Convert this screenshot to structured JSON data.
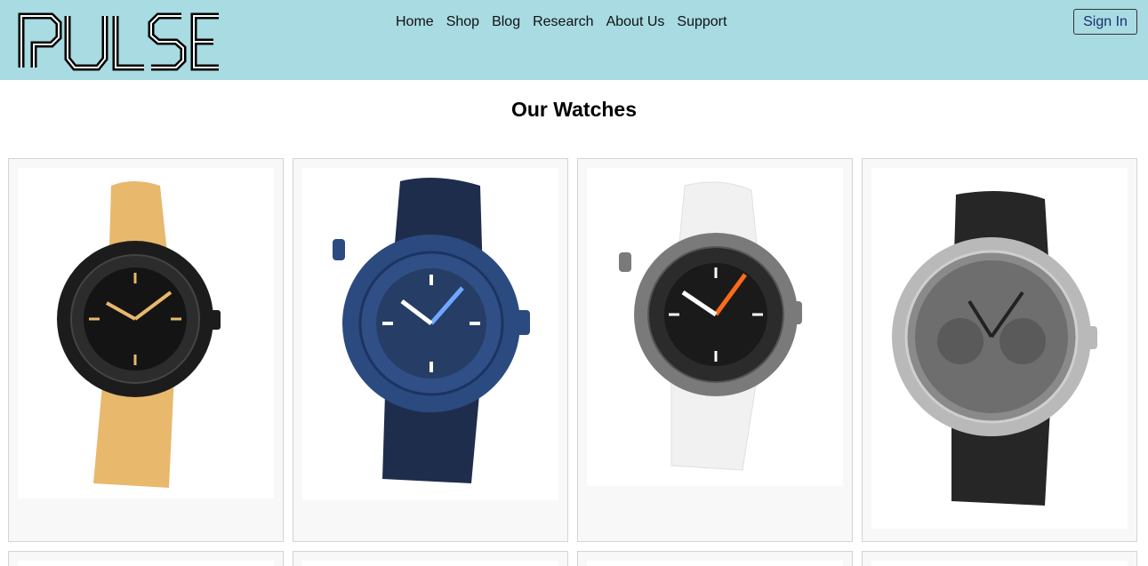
{
  "header": {
    "logo_text": "PULSE",
    "nav": [
      "Home",
      "Shop",
      "Blog",
      "Research",
      "About Us",
      "Support"
    ],
    "signin_label": "Sign In"
  },
  "main": {
    "title": "Our Watches",
    "products": [
      {
        "strap": "#e8b86d",
        "case": "#1c1c1c",
        "dial": "#141414",
        "accent": "#e8b86d"
      },
      {
        "strap": "#1f2d4d",
        "case": "#2b4a80",
        "dial": "#263d66",
        "accent": "#ffffff"
      },
      {
        "strap": "#f1f1f1",
        "case": "#7a7a7a",
        "dial": "#1a1a1a",
        "accent": "#ff6a1a"
      },
      {
        "strap": "#262626",
        "case": "#b9b9b9",
        "dial": "#6e6e6e",
        "accent": "#d8c79a"
      }
    ]
  },
  "colors": {
    "header_bg": "#a8dbe2",
    "card_bg": "#f8f8f8",
    "signin_text": "#1a2f6b"
  }
}
